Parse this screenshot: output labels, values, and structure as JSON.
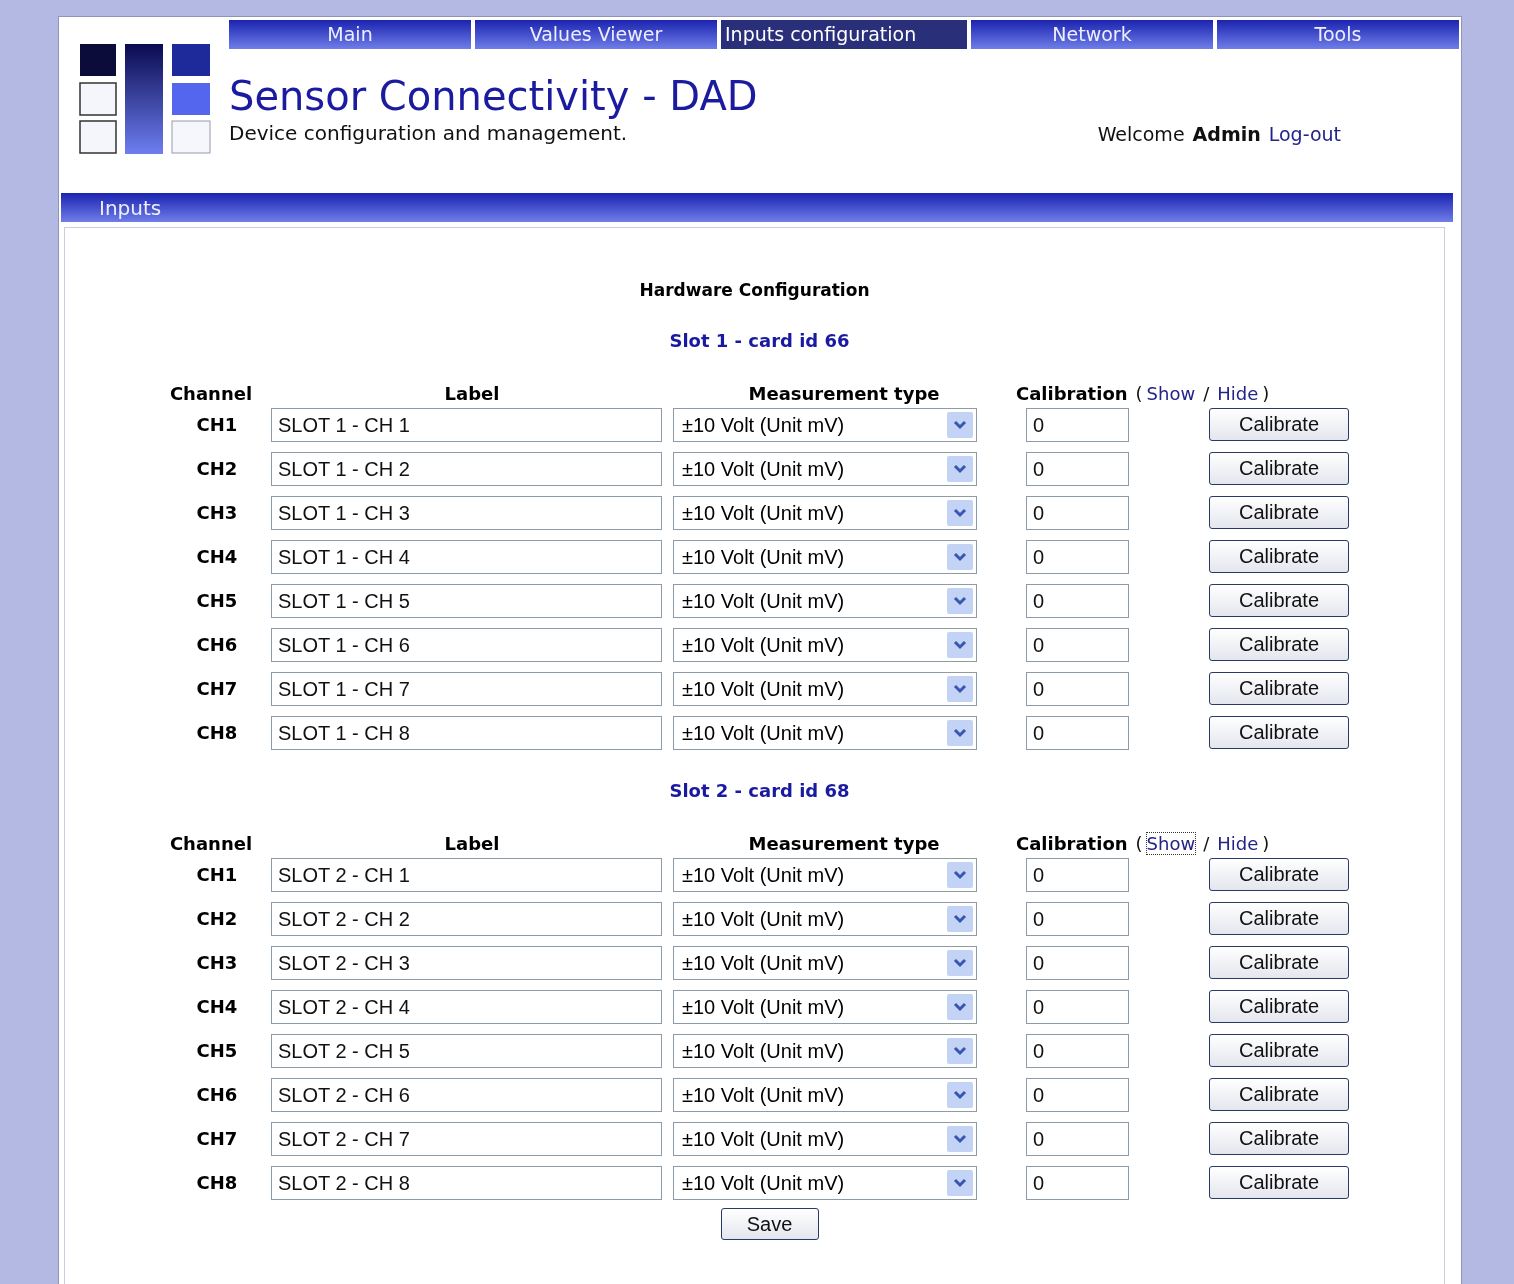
{
  "nav": [
    {
      "label": "Main",
      "selected": false
    },
    {
      "label": "Values Viewer",
      "selected": false
    },
    {
      "label": "Inputs configuration",
      "selected": true
    },
    {
      "label": "Network",
      "selected": false
    },
    {
      "label": "Tools",
      "selected": false
    }
  ],
  "header": {
    "title": "Sensor Connectivity - DAD",
    "subtitle": "Device configuration and management.",
    "welcome": "Welcome",
    "user": "Admin",
    "logout": "Log-out"
  },
  "section_bar": {
    "title": "Inputs"
  },
  "content": {
    "heading": "Hardware Configuration",
    "slots": [
      {
        "title": "Slot 1 - card id 66",
        "columns": {
          "channel": "Channel",
          "label": "Label",
          "measurement": "Measurement type",
          "calibration": "Calibration",
          "paren_open": "(",
          "show": "Show",
          "slash": "/",
          "hide": "Hide",
          "paren_close": ")"
        },
        "show_focused": false,
        "rows": [
          {
            "channel": "CH1",
            "label": "SLOT 1 - CH 1",
            "measurement": "±10 Volt (Unit mV)",
            "calibration": "0",
            "button": "Calibrate"
          },
          {
            "channel": "CH2",
            "label": "SLOT 1 - CH 2",
            "measurement": "±10 Volt (Unit mV)",
            "calibration": "0",
            "button": "Calibrate"
          },
          {
            "channel": "CH3",
            "label": "SLOT 1 - CH 3",
            "measurement": "±10 Volt (Unit mV)",
            "calibration": "0",
            "button": "Calibrate"
          },
          {
            "channel": "CH4",
            "label": "SLOT 1 - CH 4",
            "measurement": "±10 Volt (Unit mV)",
            "calibration": "0",
            "button": "Calibrate"
          },
          {
            "channel": "CH5",
            "label": "SLOT 1 - CH 5",
            "measurement": "±10 Volt (Unit mV)",
            "calibration": "0",
            "button": "Calibrate"
          },
          {
            "channel": "CH6",
            "label": "SLOT 1 - CH 6",
            "measurement": "±10 Volt (Unit mV)",
            "calibration": "0",
            "button": "Calibrate"
          },
          {
            "channel": "CH7",
            "label": "SLOT 1 - CH 7",
            "measurement": "±10 Volt (Unit mV)",
            "calibration": "0",
            "button": "Calibrate"
          },
          {
            "channel": "CH8",
            "label": "SLOT 1 - CH 8",
            "measurement": "±10 Volt (Unit mV)",
            "calibration": "0",
            "button": "Calibrate"
          }
        ]
      },
      {
        "title": "Slot 2 - card id 68",
        "columns": {
          "channel": "Channel",
          "label": "Label",
          "measurement": "Measurement type",
          "calibration": "Calibration",
          "paren_open": "(",
          "show": "Show",
          "slash": "/",
          "hide": "Hide",
          "paren_close": ")"
        },
        "show_focused": true,
        "rows": [
          {
            "channel": "CH1",
            "label": "SLOT 2 - CH 1",
            "measurement": "±10 Volt (Unit mV)",
            "calibration": "0",
            "button": "Calibrate"
          },
          {
            "channel": "CH2",
            "label": "SLOT 2 - CH 2",
            "measurement": "±10 Volt (Unit mV)",
            "calibration": "0",
            "button": "Calibrate"
          },
          {
            "channel": "CH3",
            "label": "SLOT 2 - CH 3",
            "measurement": "±10 Volt (Unit mV)",
            "calibration": "0",
            "button": "Calibrate"
          },
          {
            "channel": "CH4",
            "label": "SLOT 2 - CH 4",
            "measurement": "±10 Volt (Unit mV)",
            "calibration": "0",
            "button": "Calibrate"
          },
          {
            "channel": "CH5",
            "label": "SLOT 2 - CH 5",
            "measurement": "±10 Volt (Unit mV)",
            "calibration": "0",
            "button": "Calibrate"
          },
          {
            "channel": "CH6",
            "label": "SLOT 2 - CH 6",
            "measurement": "±10 Volt (Unit mV)",
            "calibration": "0",
            "button": "Calibrate"
          },
          {
            "channel": "CH7",
            "label": "SLOT 2 - CH 7",
            "measurement": "±10 Volt (Unit mV)",
            "calibration": "0",
            "button": "Calibrate"
          },
          {
            "channel": "CH8",
            "label": "SLOT 2 - CH 8",
            "measurement": "±10 Volt (Unit mV)",
            "calibration": "0",
            "button": "Calibrate"
          }
        ]
      }
    ],
    "save_button": "Save"
  }
}
